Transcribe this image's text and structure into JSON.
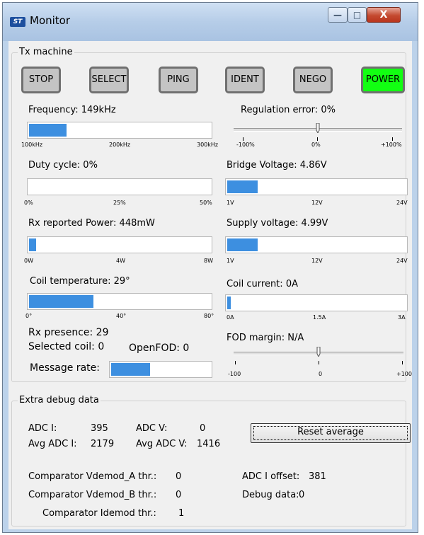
{
  "window": {
    "title": "Monitor",
    "app_icon": "ST",
    "min_glyph": "—",
    "max_glyph": "□",
    "close_glyph": "X"
  },
  "tx": {
    "legend": "Tx machine",
    "states": [
      {
        "label": "STOP",
        "active": false
      },
      {
        "label": "SELECT",
        "active": false
      },
      {
        "label": "PING",
        "active": false
      },
      {
        "label": "IDENT",
        "active": false
      },
      {
        "label": "NEGO",
        "active": false
      },
      {
        "label": "POWER",
        "active": true
      }
    ],
    "frequency": {
      "label": "Frequency:",
      "value": "149kHz",
      "fill": 0.21,
      "ticks": [
        "100kHz",
        "200kHz",
        "300kHz"
      ]
    },
    "duty": {
      "label": "Duty cycle:",
      "value": "0%",
      "fill": 0.0,
      "ticks": [
        "0%",
        "25%",
        "50%"
      ]
    },
    "rx_power": {
      "label": "Rx reported Power:",
      "value": "448mW",
      "fill": 0.04,
      "ticks": [
        "0W",
        "4W",
        "8W"
      ]
    },
    "coil_temp": {
      "label": "Coil temperature:",
      "value": "29°",
      "fill": 0.36,
      "ticks": [
        "0°",
        "40°",
        "80°"
      ]
    },
    "rx_presence": {
      "label": "Rx presence:",
      "value": "29"
    },
    "selected_coil": {
      "label": "Selected coil:",
      "value": "0"
    },
    "openfod": {
      "label": "OpenFOD:",
      "value": "0"
    },
    "message_rate": {
      "label": "Message rate:",
      "fill": 0.4
    },
    "regulation_error": {
      "label": "Regulation error:",
      "value": "0%",
      "position": 0.5,
      "ticks": [
        "-100%",
        "0%",
        "+100%"
      ]
    },
    "bridge_voltage": {
      "label": "Bridge Voltage:",
      "value": "4.86V",
      "fill": 0.17,
      "ticks": [
        "1V",
        "12V",
        "24V"
      ]
    },
    "supply_voltage": {
      "label": "Supply voltage:",
      "value": "4.99V",
      "fill": 0.17,
      "ticks": [
        "1V",
        "12V",
        "24V"
      ]
    },
    "coil_current": {
      "label": "Coil current:",
      "value": "0A",
      "fill": 0.02,
      "ticks": [
        "0A",
        "1.5A",
        "3A"
      ]
    },
    "fod_margin": {
      "label": "FOD margin:",
      "value": "N/A",
      "position": 0.5,
      "ticks": [
        "-100",
        "0",
        "+100"
      ]
    }
  },
  "debug": {
    "legend": "Extra debug data",
    "adc_i": {
      "label": "ADC I:",
      "value": "395"
    },
    "adc_v": {
      "label": "ADC V:",
      "value": "0"
    },
    "avg_adc_i": {
      "label": "Avg ADC I:",
      "value": "2179"
    },
    "avg_adc_v": {
      "label": "Avg ADC V:",
      "value": "1416"
    },
    "reset_label": "Reset average",
    "comp_a": {
      "label": "Comparator Vdemod_A thr.:",
      "value": "0"
    },
    "comp_b": {
      "label": "Comparator Vdemod_B thr.:",
      "value": "0"
    },
    "comp_i": {
      "label": "Comparator Idemod thr.:",
      "value": "1"
    },
    "adc_i_offset": {
      "label": "ADC I offset:",
      "value": "381"
    },
    "debug_data": {
      "label": "Debug data:",
      "value": "0"
    }
  }
}
